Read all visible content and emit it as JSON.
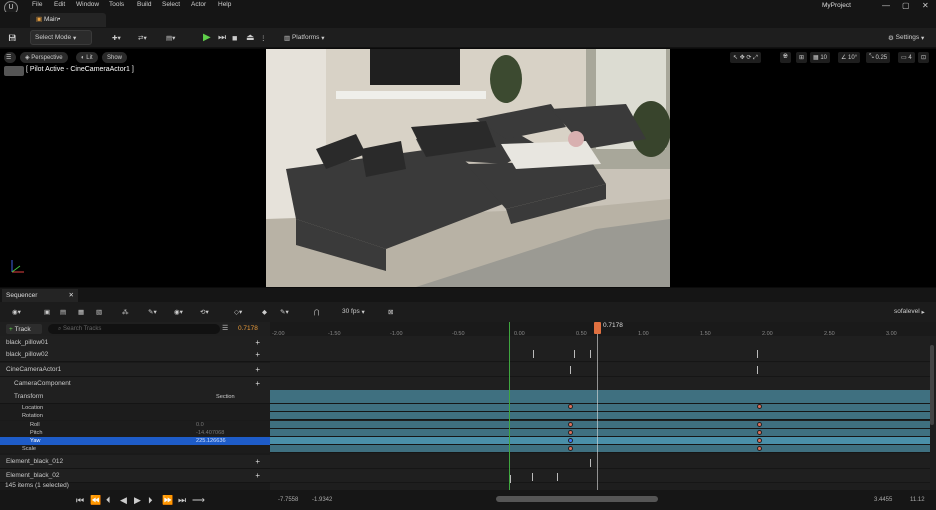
{
  "menubar": {
    "logo": "U",
    "items": [
      "File",
      "Edit",
      "Window",
      "Tools",
      "Build",
      "Select",
      "Actor",
      "Help"
    ],
    "project": "MyProject",
    "window_buttons": [
      "—",
      "▢",
      "✕"
    ]
  },
  "tabs": {
    "main": "Main•"
  },
  "toolbar": {
    "select_mode": "Select Mode",
    "platforms": "Platforms",
    "settings": "Settings"
  },
  "viewport": {
    "perspective": "Perspective",
    "lit": "Lit",
    "show": "Show",
    "pilot": "[ Pilot Active - CineCameraActor1 ]",
    "grid_snap": "10",
    "rot_snap": "10°",
    "scale_snap": "0.25",
    "cam_speed": "4"
  },
  "sequencer": {
    "tab": "Sequencer",
    "fps": "30 fps",
    "level": "sofalevel",
    "current_frame": "0.7178",
    "track_btn": "Track",
    "search_placeholder": "Search Tracks",
    "time_field": "0.7178",
    "tracks": [
      {
        "label": "black_pillow01"
      },
      {
        "label": "black_pillow02"
      },
      {
        "label": "CineCameraActor1"
      },
      {
        "label": "CameraComponent"
      },
      {
        "label": "Transform",
        "extra": "Section"
      },
      {
        "label": "Location"
      },
      {
        "label": "Rotation"
      },
      {
        "label": "Roll",
        "value": "0.0"
      },
      {
        "label": "Pitch",
        "value": "-14.407068"
      },
      {
        "label": "Yaw",
        "value": "225.126636"
      },
      {
        "label": "Scale"
      },
      {
        "label": "Element_black_012"
      },
      {
        "label": "Element_black_02"
      }
    ],
    "count": "145 items (1 selected)",
    "ruler": [
      "-1.50",
      "-1.00",
      "-0.50",
      "0.00",
      "0.50",
      "1.00",
      "1.50",
      "2.00",
      "2.50",
      "3.00"
    ],
    "ruler_start": "-2.00",
    "bottom": {
      "left1": "-7.7558",
      "left2": "-1.9342",
      "right1": "3.4455",
      "right2": "11.12"
    }
  }
}
